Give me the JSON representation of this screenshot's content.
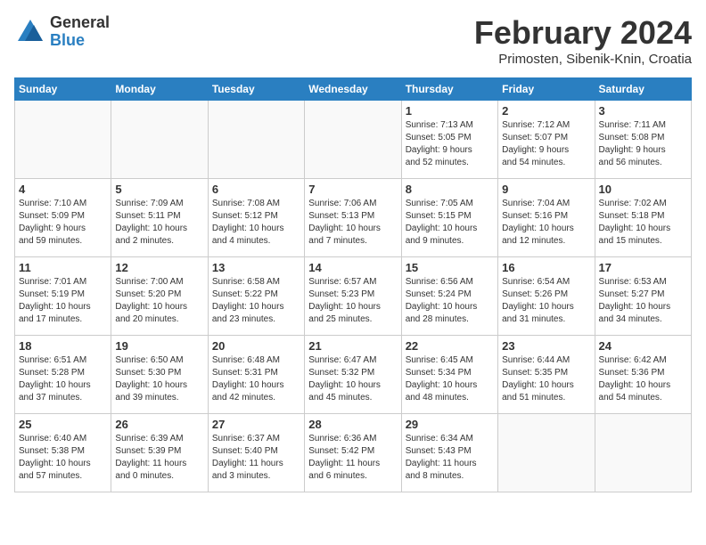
{
  "header": {
    "logo_general": "General",
    "logo_blue": "Blue",
    "title": "February 2024",
    "location": "Primosten, Sibenik-Knin, Croatia"
  },
  "days_of_week": [
    "Sunday",
    "Monday",
    "Tuesday",
    "Wednesday",
    "Thursday",
    "Friday",
    "Saturday"
  ],
  "weeks": [
    [
      {
        "day": "",
        "info": ""
      },
      {
        "day": "",
        "info": ""
      },
      {
        "day": "",
        "info": ""
      },
      {
        "day": "",
        "info": ""
      },
      {
        "day": "1",
        "info": "Sunrise: 7:13 AM\nSunset: 5:05 PM\nDaylight: 9 hours\nand 52 minutes."
      },
      {
        "day": "2",
        "info": "Sunrise: 7:12 AM\nSunset: 5:07 PM\nDaylight: 9 hours\nand 54 minutes."
      },
      {
        "day": "3",
        "info": "Sunrise: 7:11 AM\nSunset: 5:08 PM\nDaylight: 9 hours\nand 56 minutes."
      }
    ],
    [
      {
        "day": "4",
        "info": "Sunrise: 7:10 AM\nSunset: 5:09 PM\nDaylight: 9 hours\nand 59 minutes."
      },
      {
        "day": "5",
        "info": "Sunrise: 7:09 AM\nSunset: 5:11 PM\nDaylight: 10 hours\nand 2 minutes."
      },
      {
        "day": "6",
        "info": "Sunrise: 7:08 AM\nSunset: 5:12 PM\nDaylight: 10 hours\nand 4 minutes."
      },
      {
        "day": "7",
        "info": "Sunrise: 7:06 AM\nSunset: 5:13 PM\nDaylight: 10 hours\nand 7 minutes."
      },
      {
        "day": "8",
        "info": "Sunrise: 7:05 AM\nSunset: 5:15 PM\nDaylight: 10 hours\nand 9 minutes."
      },
      {
        "day": "9",
        "info": "Sunrise: 7:04 AM\nSunset: 5:16 PM\nDaylight: 10 hours\nand 12 minutes."
      },
      {
        "day": "10",
        "info": "Sunrise: 7:02 AM\nSunset: 5:18 PM\nDaylight: 10 hours\nand 15 minutes."
      }
    ],
    [
      {
        "day": "11",
        "info": "Sunrise: 7:01 AM\nSunset: 5:19 PM\nDaylight: 10 hours\nand 17 minutes."
      },
      {
        "day": "12",
        "info": "Sunrise: 7:00 AM\nSunset: 5:20 PM\nDaylight: 10 hours\nand 20 minutes."
      },
      {
        "day": "13",
        "info": "Sunrise: 6:58 AM\nSunset: 5:22 PM\nDaylight: 10 hours\nand 23 minutes."
      },
      {
        "day": "14",
        "info": "Sunrise: 6:57 AM\nSunset: 5:23 PM\nDaylight: 10 hours\nand 25 minutes."
      },
      {
        "day": "15",
        "info": "Sunrise: 6:56 AM\nSunset: 5:24 PM\nDaylight: 10 hours\nand 28 minutes."
      },
      {
        "day": "16",
        "info": "Sunrise: 6:54 AM\nSunset: 5:26 PM\nDaylight: 10 hours\nand 31 minutes."
      },
      {
        "day": "17",
        "info": "Sunrise: 6:53 AM\nSunset: 5:27 PM\nDaylight: 10 hours\nand 34 minutes."
      }
    ],
    [
      {
        "day": "18",
        "info": "Sunrise: 6:51 AM\nSunset: 5:28 PM\nDaylight: 10 hours\nand 37 minutes."
      },
      {
        "day": "19",
        "info": "Sunrise: 6:50 AM\nSunset: 5:30 PM\nDaylight: 10 hours\nand 39 minutes."
      },
      {
        "day": "20",
        "info": "Sunrise: 6:48 AM\nSunset: 5:31 PM\nDaylight: 10 hours\nand 42 minutes."
      },
      {
        "day": "21",
        "info": "Sunrise: 6:47 AM\nSunset: 5:32 PM\nDaylight: 10 hours\nand 45 minutes."
      },
      {
        "day": "22",
        "info": "Sunrise: 6:45 AM\nSunset: 5:34 PM\nDaylight: 10 hours\nand 48 minutes."
      },
      {
        "day": "23",
        "info": "Sunrise: 6:44 AM\nSunset: 5:35 PM\nDaylight: 10 hours\nand 51 minutes."
      },
      {
        "day": "24",
        "info": "Sunrise: 6:42 AM\nSunset: 5:36 PM\nDaylight: 10 hours\nand 54 minutes."
      }
    ],
    [
      {
        "day": "25",
        "info": "Sunrise: 6:40 AM\nSunset: 5:38 PM\nDaylight: 10 hours\nand 57 minutes."
      },
      {
        "day": "26",
        "info": "Sunrise: 6:39 AM\nSunset: 5:39 PM\nDaylight: 11 hours\nand 0 minutes."
      },
      {
        "day": "27",
        "info": "Sunrise: 6:37 AM\nSunset: 5:40 PM\nDaylight: 11 hours\nand 3 minutes."
      },
      {
        "day": "28",
        "info": "Sunrise: 6:36 AM\nSunset: 5:42 PM\nDaylight: 11 hours\nand 6 minutes."
      },
      {
        "day": "29",
        "info": "Sunrise: 6:34 AM\nSunset: 5:43 PM\nDaylight: 11 hours\nand 8 minutes."
      },
      {
        "day": "",
        "info": ""
      },
      {
        "day": "",
        "info": ""
      }
    ]
  ]
}
